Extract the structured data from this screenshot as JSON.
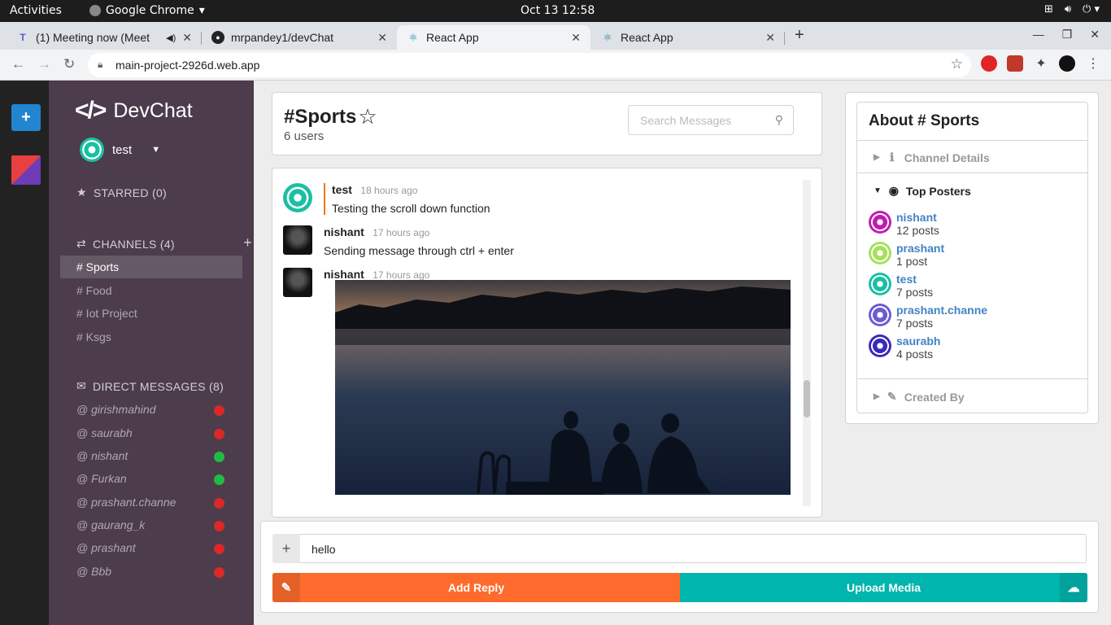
{
  "os": {
    "activities": "Activities",
    "app": "Google Chrome",
    "clock": "Oct 13  12:58"
  },
  "browser": {
    "tabs": [
      {
        "title": "(1) Meeting now (Meet",
        "icon": "teams-icon"
      },
      {
        "title": "mrpandey1/devChat",
        "icon": "github-icon"
      },
      {
        "title": "React App",
        "icon": "react-icon",
        "active": true
      },
      {
        "title": "React App",
        "icon": "react-icon"
      }
    ],
    "url": "main-project-2926d.web.app"
  },
  "sidebar": {
    "brand": "DevChat",
    "user": "test",
    "starred": "STARRED (0)",
    "channels_label": "CHANNELS (4)",
    "channels": [
      "# Sports",
      "# Food",
      "# Iot Project",
      "# Ksgs"
    ],
    "dm_label": "DIRECT MESSAGES (8)",
    "dms": [
      {
        "name": "@ girishmahind",
        "status": "offline"
      },
      {
        "name": "@ saurabh",
        "status": "offline"
      },
      {
        "name": "@ nishant",
        "status": "online"
      },
      {
        "name": "@ Furkan",
        "status": "online"
      },
      {
        "name": "@ prashant.channe",
        "status": "offline"
      },
      {
        "name": "@ gaurang_k",
        "status": "offline"
      },
      {
        "name": "@ prashant",
        "status": "offline"
      },
      {
        "name": "@ Bbb",
        "status": "offline"
      }
    ],
    "colors": {
      "online": "#21ba45",
      "offline": "#db2828",
      "background": "#4c3c4c"
    }
  },
  "header": {
    "channel": "#Sports",
    "users": "6 users",
    "search_placeholder": "Search Messages"
  },
  "messages": [
    {
      "author": "test",
      "time": "18 hours ago",
      "text": "Testing the scroll down function"
    },
    {
      "author": "nishant",
      "time": "17 hours ago",
      "text": "Sending message through ctrl + enter"
    },
    {
      "author": "nishant",
      "time": "17 hours ago",
      "text": ""
    }
  ],
  "meta": {
    "title": "About # Sports",
    "channel_details": "Channel Details",
    "top_posters": "Top Posters",
    "created_by": "Created By",
    "posters": [
      {
        "name": "nishant",
        "count": "12 posts",
        "color": "#c21bb0"
      },
      {
        "name": "prashant",
        "count": "1 post",
        "color": "#a6e05a"
      },
      {
        "name": "test",
        "count": "7 posts",
        "color": "#1bbfa3"
      },
      {
        "name": "prashant.channe",
        "count": "7 posts",
        "color": "#6a5bd6"
      },
      {
        "name": "saurabh",
        "count": "4 posts",
        "color": "#3a2bb8"
      }
    ]
  },
  "form": {
    "message_value": "hello",
    "add_reply": "Add Reply",
    "upload_media": "Upload Media",
    "colors": {
      "reply": "#fe6b2c",
      "upload": "#00b5ad"
    }
  }
}
